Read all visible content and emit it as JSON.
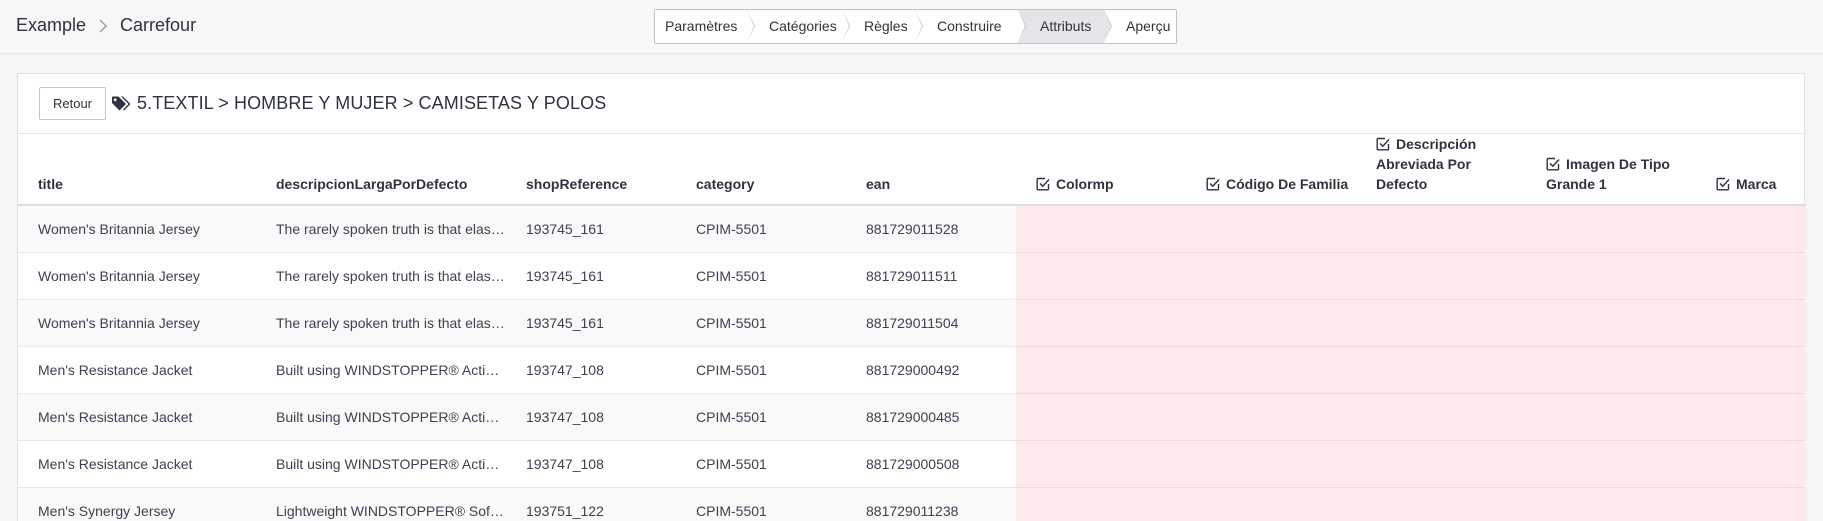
{
  "breadcrumb": {
    "root": "Example",
    "current": "Carrefour"
  },
  "steps": [
    "Paramètres",
    "Catégories",
    "Règles",
    "Construire",
    "Attributs",
    "Aperçu"
  ],
  "active_step": "Attributs",
  "panel": {
    "back_label": "Retour",
    "category_path": "5.TEXTIL > HOMBRE Y MUJER > CAMISETAS Y POLOS"
  },
  "columns": {
    "title": "title",
    "description": "descripcionLargaPorDefecto",
    "shop_reference": "shopReference",
    "category": "category",
    "ean": "ean",
    "attr1": "Colormp",
    "attr2": "Código De Familia",
    "attr3": "Descripción Abreviada Por Defecto",
    "attr4": "Imagen De Tipo Grande 1",
    "attr5": "Marca"
  },
  "rows": [
    {
      "title": "Women's Britannia Jersey",
      "description": "The rarely spoken truth is that elastane",
      "shop_reference": "193745_161",
      "category": "CPIM-5501",
      "ean": "881729011528"
    },
    {
      "title": "Women's Britannia Jersey",
      "description": "The rarely spoken truth is that elastane",
      "shop_reference": "193745_161",
      "category": "CPIM-5501",
      "ean": "881729011511"
    },
    {
      "title": "Women's Britannia Jersey",
      "description": "The rarely spoken truth is that elastane",
      "shop_reference": "193745_161",
      "category": "CPIM-5501",
      "ean": "881729011504"
    },
    {
      "title": "Men's Resistance Jacket",
      "description": "Built using WINDSTOPPER® Active Shell",
      "shop_reference": "193747_108",
      "category": "CPIM-5501",
      "ean": "881729000492"
    },
    {
      "title": "Men's Resistance Jacket",
      "description": "Built using WINDSTOPPER® Active Shell",
      "shop_reference": "193747_108",
      "category": "CPIM-5501",
      "ean": "881729000485"
    },
    {
      "title": "Men's Resistance Jacket",
      "description": "Built using WINDSTOPPER® Active Shell",
      "shop_reference": "193747_108",
      "category": "CPIM-5501",
      "ean": "881729000508"
    },
    {
      "title": "Men's Synergy Jersey",
      "description": "Lightweight WINDSTOPPER® Soft Shell",
      "shop_reference": "193751_122",
      "category": "CPIM-5501",
      "ean": "881729011238"
    }
  ],
  "colors": {
    "missing_attribute": "#fde8ea",
    "active_step": "#e4e5e8"
  }
}
